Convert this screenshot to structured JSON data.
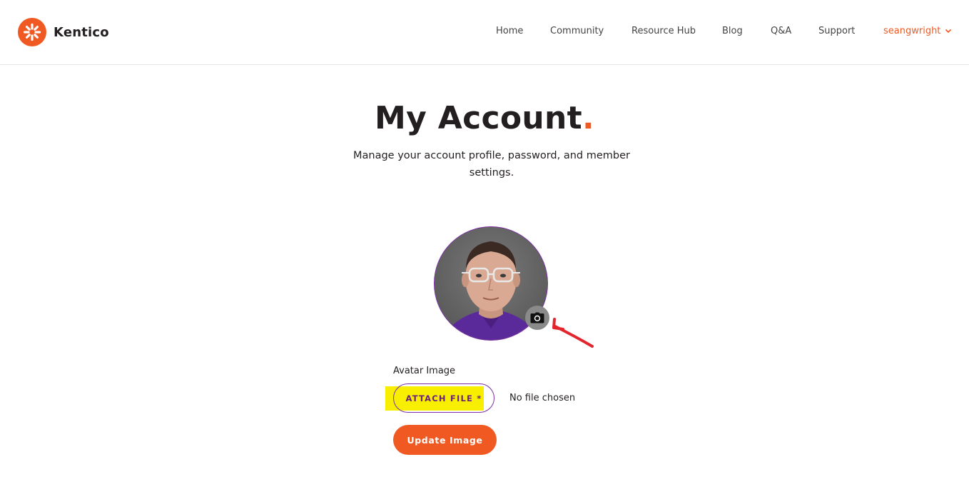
{
  "header": {
    "logo_text": "Kentico",
    "nav": {
      "home": "Home",
      "community": "Community",
      "resource_hub": "Resource Hub",
      "blog": "Blog",
      "qa": "Q&A",
      "support": "Support",
      "user": "seangwright"
    }
  },
  "page": {
    "title": "My Account",
    "title_dot": ".",
    "subtitle": "Manage your account profile, password, and member settings."
  },
  "avatar": {
    "change_icon": "camera-icon"
  },
  "form": {
    "field_label": "Avatar Image",
    "attach_label": "ATTACH FILE *",
    "file_status": "No file chosen",
    "submit_label": "Update Image"
  },
  "colors": {
    "brand_orange": "#f05a22",
    "accent_purple": "#7d2fa6",
    "highlight_yellow": "#f7ee00",
    "annotation_red": "#e3262e"
  }
}
